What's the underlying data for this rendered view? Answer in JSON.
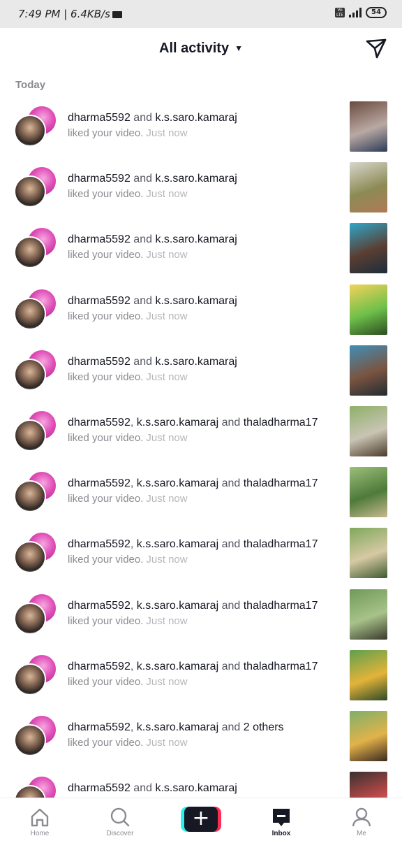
{
  "status_bar": {
    "time_text": "7:49 PM | 6.4KB/s",
    "battery": "54"
  },
  "header": {
    "title": "All activity",
    "caret": "▼",
    "send_icon": "send-icon"
  },
  "section_label": "Today",
  "notifications": [
    {
      "user1": "dharma5592",
      "sep1": "and",
      "user2": "k.s.saro.kamaraj",
      "sep2": "",
      "user3": "",
      "action": "liked your video.",
      "time": "Just now",
      "thumb_colors": [
        "#6a4a3e",
        "#b9a9a3",
        "#2d3b57"
      ]
    },
    {
      "user1": "dharma5592",
      "sep1": "and",
      "user2": "k.s.saro.kamaraj",
      "sep2": "",
      "user3": "",
      "action": "liked your video.",
      "time": "Just now",
      "thumb_colors": [
        "#d8d6cc",
        "#8c8b55",
        "#b07a55"
      ]
    },
    {
      "user1": "dharma5592",
      "sep1": "and",
      "user2": "k.s.saro.kamaraj",
      "sep2": "",
      "user3": "",
      "action": "liked your video.",
      "time": "Just now",
      "thumb_colors": [
        "#2fa7c9",
        "#5a3e32",
        "#1c2d3c"
      ]
    },
    {
      "user1": "dharma5592",
      "sep1": "and",
      "user2": "k.s.saro.kamaraj",
      "sep2": "",
      "user3": "",
      "action": "liked your video.",
      "time": "Just now",
      "thumb_colors": [
        "#f2d25a",
        "#6fc04a",
        "#2b4d20"
      ]
    },
    {
      "user1": "dharma5592",
      "sep1": "and",
      "user2": "k.s.saro.kamaraj",
      "sep2": "",
      "user3": "",
      "action": "liked your video.",
      "time": "Just now",
      "thumb_colors": [
        "#3f8fb8",
        "#7a5440",
        "#222b33"
      ]
    },
    {
      "user1": "dharma5592",
      "sep1": ",",
      "user2": "k.s.saro.kamaraj",
      "sep2": "and",
      "user3": "thaladharma17",
      "action": "liked your video.",
      "time": "Just now",
      "thumb_colors": [
        "#8fb06a",
        "#c9c4b4",
        "#4c3b2a"
      ]
    },
    {
      "user1": "dharma5592",
      "sep1": ",",
      "user2": "k.s.saro.kamaraj",
      "sep2": "and",
      "user3": "thaladharma17",
      "action": "liked your video.",
      "time": "Just now",
      "thumb_colors": [
        "#9cbf7a",
        "#4e7a3a",
        "#c7b98f"
      ]
    },
    {
      "user1": "dharma5592",
      "sep1": ",",
      "user2": "k.s.saro.kamaraj",
      "sep2": "and",
      "user3": "thaladharma17",
      "action": "liked your video.",
      "time": "Just now",
      "thumb_colors": [
        "#7fa85d",
        "#d6c9a3",
        "#3e5a30"
      ]
    },
    {
      "user1": "dharma5592",
      "sep1": ",",
      "user2": "k.s.saro.kamaraj",
      "sep2": "and",
      "user3": "thaladharma17",
      "action": "liked your video.",
      "time": "Just now",
      "thumb_colors": [
        "#6f9a58",
        "#a8c28a",
        "#3a3a2c"
      ]
    },
    {
      "user1": "dharma5592",
      "sep1": ",",
      "user2": "k.s.saro.kamaraj",
      "sep2": "and",
      "user3": "thaladharma17",
      "action": "liked your video.",
      "time": "Just now",
      "thumb_colors": [
        "#5fa04e",
        "#e3b33a",
        "#2e4a27"
      ]
    },
    {
      "user1": "dharma5592",
      "sep1": ",",
      "user2": "k.s.saro.kamaraj",
      "sep2": "and",
      "user3": "2 others",
      "action": "liked your video.",
      "time": "Just now",
      "thumb_colors": [
        "#7fb06a",
        "#e2b24a",
        "#3a2a20"
      ]
    },
    {
      "user1": "dharma5592",
      "sep1": "and",
      "user2": "k.s.saro.kamaraj",
      "sep2": "",
      "user3": "",
      "action": "",
      "time": "",
      "thumb_colors": [
        "#3a3030",
        "#c24a4a",
        "#d9a38a"
      ]
    }
  ],
  "bottom_nav": [
    {
      "label": "Home",
      "icon": "home-icon",
      "active": false
    },
    {
      "label": "Discover",
      "icon": "search-icon",
      "active": false
    },
    {
      "label": "",
      "icon": "plus-icon",
      "active": false
    },
    {
      "label": "Inbox",
      "icon": "inbox-icon",
      "active": true
    },
    {
      "label": "Me",
      "icon": "profile-icon",
      "active": false
    }
  ],
  "colors": {
    "accent_pink": "#fe2c55",
    "accent_cyan": "#25f4ee",
    "text_primary": "#161823",
    "text_secondary": "#8a8b91"
  }
}
